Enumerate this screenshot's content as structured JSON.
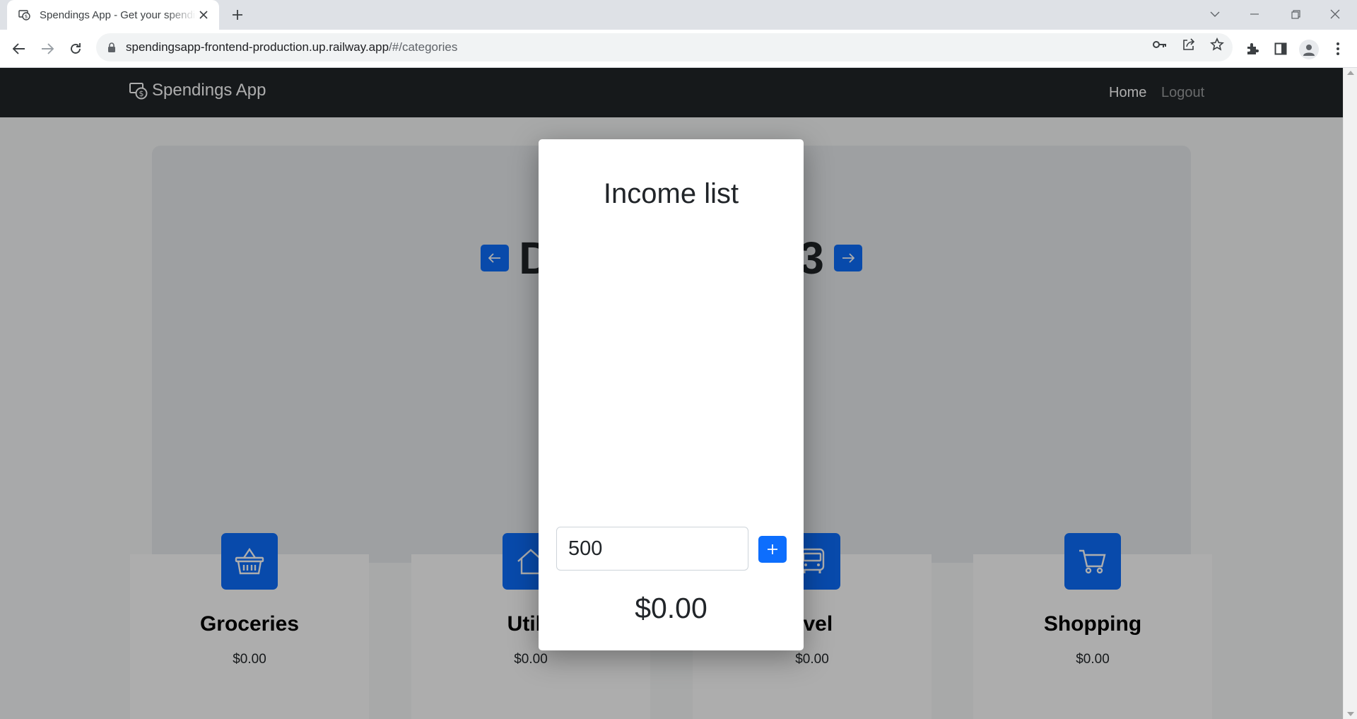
{
  "browser": {
    "tab_title": "Spendings App - Get your spendings under control",
    "url_host": "spendingsapp-frontend-production.up.railway.app",
    "url_path": "/#/categories"
  },
  "navbar": {
    "brand": "Spendings App",
    "home": "Home",
    "logout": "Logout"
  },
  "main": {
    "month_title": "D",
    "month_title_end": "3"
  },
  "categories": [
    {
      "name": "Groceries",
      "amount": "$0.00",
      "icon": "basket-icon"
    },
    {
      "name": "Utilit",
      "amount": "$0.00",
      "icon": "house-icon"
    },
    {
      "name": "avel",
      "amount": "$0.00",
      "icon": "bus-icon"
    },
    {
      "name": "Shopping",
      "amount": "$0.00",
      "icon": "cart-icon"
    }
  ],
  "modal": {
    "title": "Income list",
    "input_value": "500",
    "total": "$0.00"
  },
  "colors": {
    "primary": "#0d6efd",
    "navbar": "#212529"
  }
}
